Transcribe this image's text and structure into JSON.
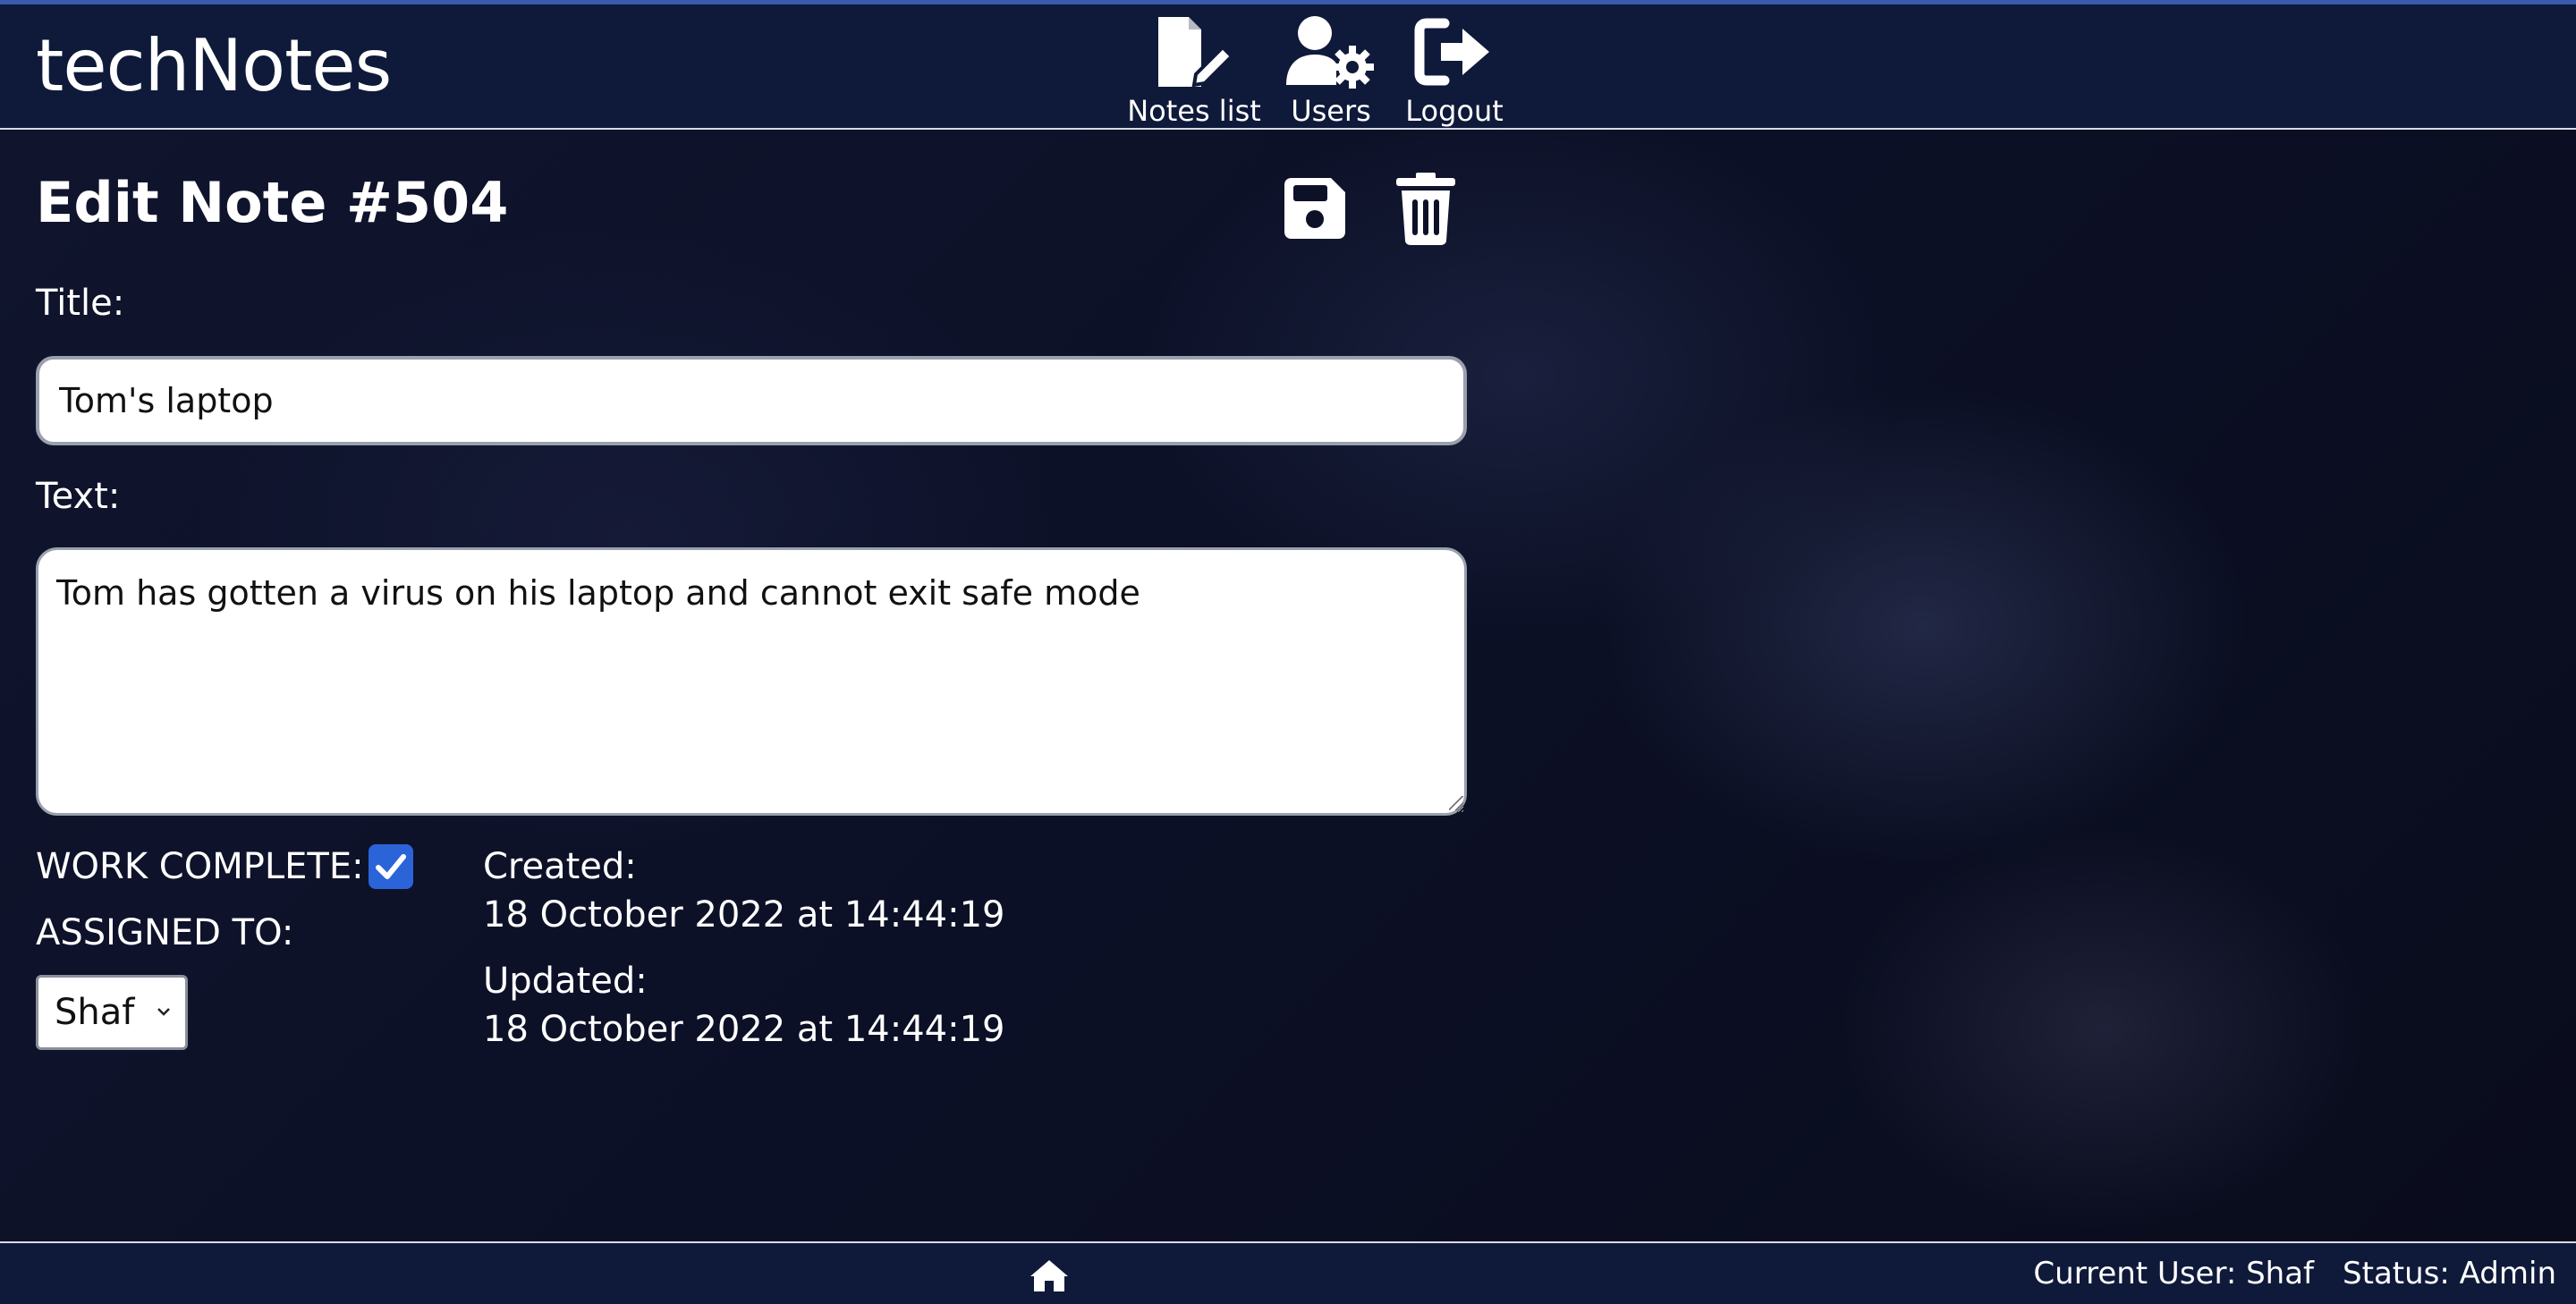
{
  "app": {
    "brand": "techNotes"
  },
  "nav": {
    "notes_label": "Notes list",
    "users_label": "Users",
    "logout_label": "Logout"
  },
  "page": {
    "title": "Edit Note #504",
    "save_icon": "floppy-disk-icon",
    "delete_icon": "trash-icon"
  },
  "form": {
    "title_label": "Title:",
    "title_value": "Tom's laptop",
    "text_label": "Text:",
    "text_value": "Tom has gotten a virus on his laptop and cannot exit safe mode",
    "complete_label": "WORK COMPLETE:",
    "complete_checked": true,
    "assigned_label": "ASSIGNED TO:",
    "assigned_value": "Shaf"
  },
  "meta": {
    "created_label": "Created:",
    "created_value": "18 October 2022 at 14:44:19",
    "updated_label": "Updated:",
    "updated_value": "18 October 2022 at 14:44:19"
  },
  "footer": {
    "current_user": "Current User: Shaf",
    "status": "Status: Admin"
  },
  "colors": {
    "header_bg": "#0f1a3a",
    "checkbox_accent": "#2b64d8",
    "page_bg": "#0b0f24"
  }
}
